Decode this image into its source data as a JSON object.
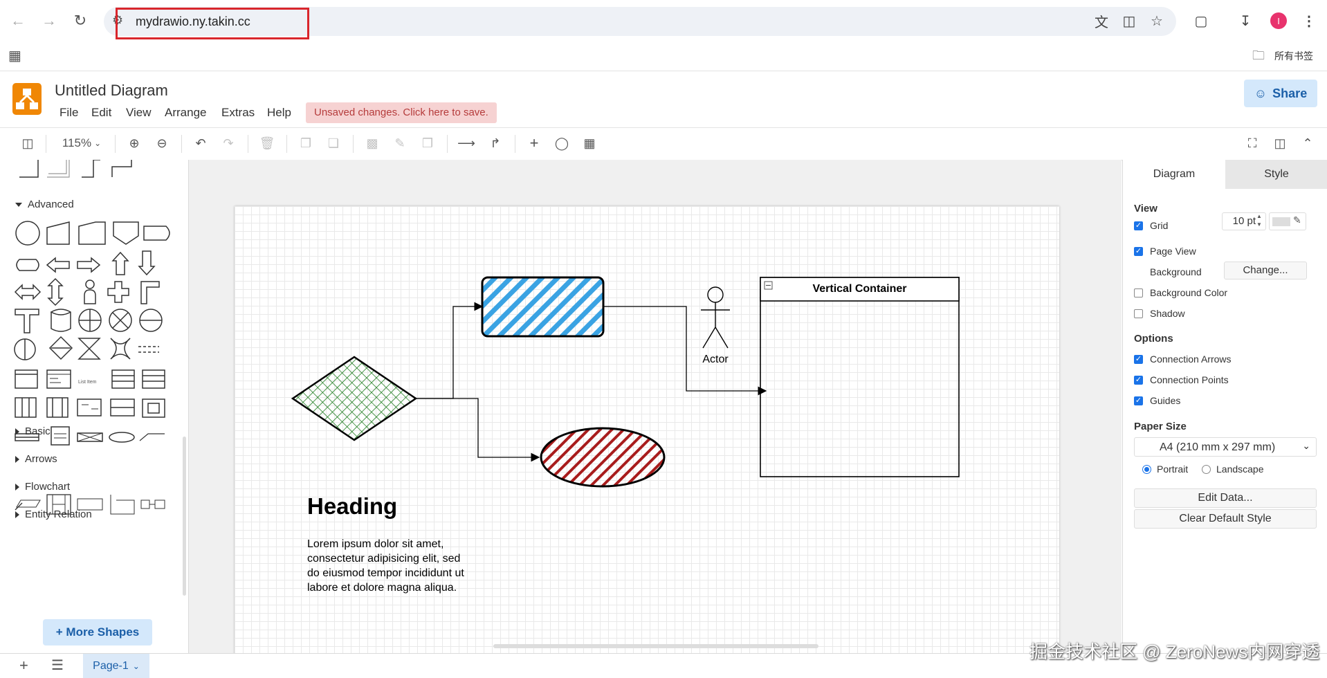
{
  "browser": {
    "url": "mydrawio.ny.takin.cc",
    "bookmarks_label": "所有书签",
    "profile_initial": "I",
    "profile_color": "#e8336d",
    "highlight_color": "#d9262c"
  },
  "app": {
    "title": "Untitled Diagram",
    "menu": [
      "File",
      "Edit",
      "View",
      "Arrange",
      "Extras",
      "Help"
    ],
    "unsaved_notice": "Unsaved changes. Click here to save.",
    "share_label": "Share",
    "logo_color": "#f08705"
  },
  "toolbar": {
    "zoom": "115%"
  },
  "sidebar": {
    "advanced_label": "Advanced",
    "list_item_label": "List Item",
    "collapsed_sections": [
      "Basic",
      "Arrows",
      "Flowchart",
      "Entity Relation"
    ],
    "more_shapes_label": "+ More Shapes"
  },
  "canvas": {
    "heading": "Heading",
    "paragraph_lines": [
      "Lorem ipsum dolor sit amet,",
      "consectetur adipisicing elit, sed",
      "do eiusmod tempor incididunt ut",
      "labore et dolore magna aliqua."
    ],
    "actor_label": "Actor",
    "container_title": "Vertical Container",
    "colors": {
      "diamond_hatch": "#1a7a1a",
      "rect_hatch": "#3aa3e3",
      "ellipse_hatch": "#a81c1c"
    }
  },
  "format_panel": {
    "tabs": [
      "Diagram",
      "Style"
    ],
    "view_heading": "View",
    "grid_label": "Grid",
    "grid_size": "10 pt",
    "page_view_label": "Page View",
    "background_label": "Background",
    "change_label": "Change...",
    "background_color_label": "Background Color",
    "shadow_label": "Shadow",
    "options_heading": "Options",
    "connection_arrows_label": "Connection Arrows",
    "connection_points_label": "Connection Points",
    "guides_label": "Guides",
    "paper_size_heading": "Paper Size",
    "paper_size_value": "A4 (210 mm x 297 mm)",
    "portrait_label": "Portrait",
    "landscape_label": "Landscape",
    "edit_data_label": "Edit Data...",
    "clear_style_label": "Clear Default Style"
  },
  "bottom": {
    "page_tab": "Page-1"
  },
  "watermark": "掘金技术社区 @ ZeroNews内网穿透"
}
